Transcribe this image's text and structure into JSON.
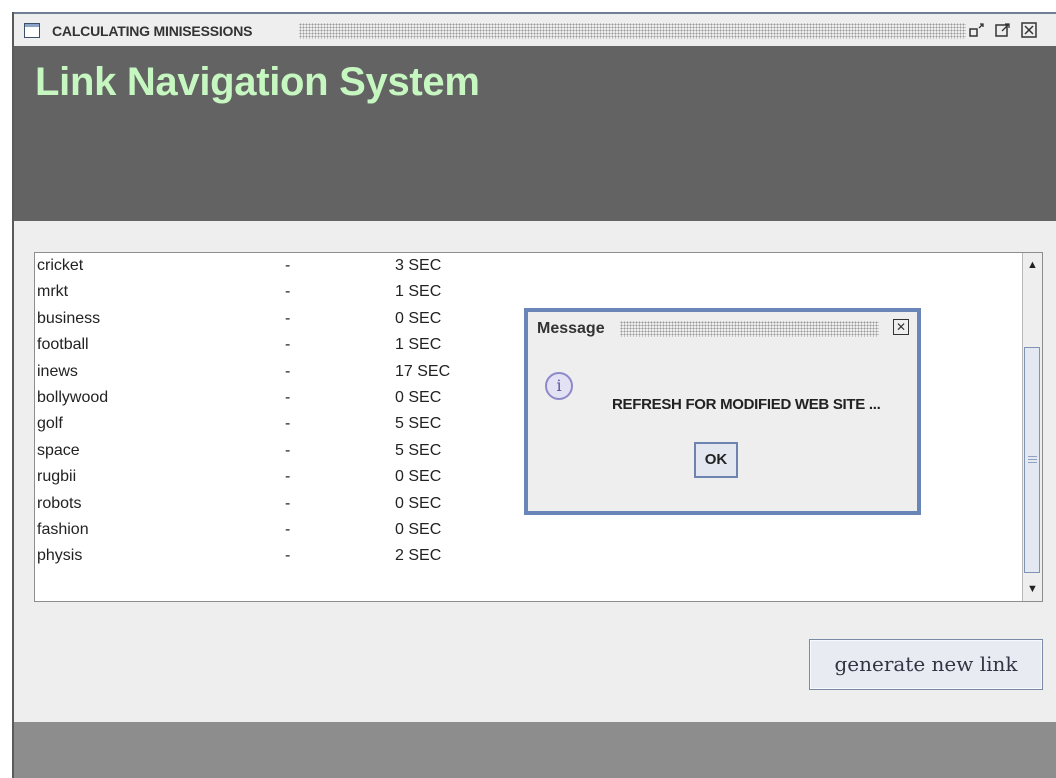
{
  "window": {
    "title": "CALCULATING MINISESSIONS",
    "controls": {
      "restore": "restore-icon",
      "maximize": "maximize-icon",
      "close": "close-icon"
    }
  },
  "app": {
    "title": "Link Navigation System"
  },
  "list": {
    "rows": [
      {
        "name": "cricket",
        "dash": "-",
        "time": "3 SEC"
      },
      {
        "name": "mrkt",
        "dash": "-",
        "time": "1 SEC"
      },
      {
        "name": "business",
        "dash": "-",
        "time": "0 SEC"
      },
      {
        "name": "football",
        "dash": "-",
        "time": "1 SEC"
      },
      {
        "name": "inews",
        "dash": "-",
        "time": "17 SEC"
      },
      {
        "name": "bollywood",
        "dash": "-",
        "time": "0 SEC"
      },
      {
        "name": "golf",
        "dash": "-",
        "time": "5 SEC"
      },
      {
        "name": "space",
        "dash": "-",
        "time": "5 SEC"
      },
      {
        "name": "rugbii",
        "dash": "-",
        "time": "0 SEC"
      },
      {
        "name": "robots",
        "dash": "-",
        "time": "0 SEC"
      },
      {
        "name": "fashion",
        "dash": "-",
        "time": "0 SEC"
      },
      {
        "name": "physis",
        "dash": "-",
        "time": "2 SEC"
      }
    ],
    "scroll_up": "▲",
    "scroll_down": "▼"
  },
  "buttons": {
    "generate": "generate new link"
  },
  "dialog": {
    "title": "Message",
    "icon_glyph": "i",
    "message": "REFRESH FOR MODIFIED WEB SITE ...",
    "ok": "OK",
    "close_glyph": "✕"
  }
}
